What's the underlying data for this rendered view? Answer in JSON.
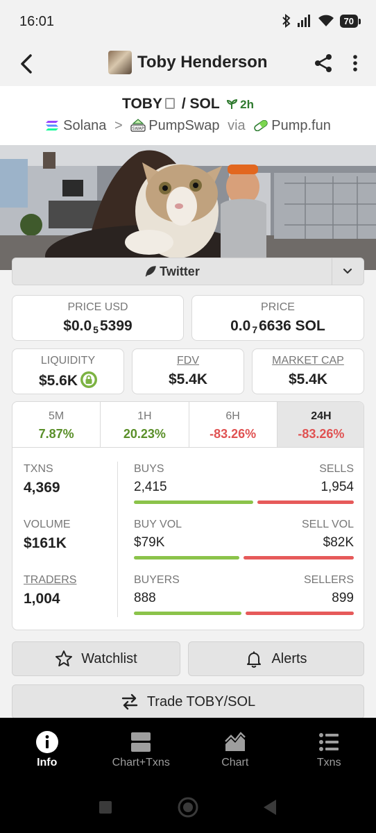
{
  "status_bar": {
    "time": "16:01",
    "battery": "70"
  },
  "header": {
    "title": "Toby Henderson"
  },
  "pair": {
    "base": "TOBY",
    "separator": "/",
    "quote": "SOL",
    "age": "2h",
    "chain": "Solana",
    "chevron": ">",
    "dex": "PumpSwap",
    "via": "via",
    "launchpad": "Pump.fun",
    "swap_badge": "SWAP"
  },
  "twitter": {
    "label": "Twitter"
  },
  "stats": {
    "price_usd": {
      "label": "PRICE USD",
      "prefix": "$0.0",
      "zeros": "5",
      "digits": "5399"
    },
    "price_native": {
      "label": "PRICE",
      "prefix": "0.0",
      "zeros": "7",
      "digits": "6636 SOL"
    },
    "liquidity": {
      "label": "LIQUIDITY",
      "value": "$5.6K"
    },
    "fdv": {
      "label": "FDV",
      "value": "$5.4K"
    },
    "market_cap": {
      "label": "MARKET CAP",
      "value": "$5.4K"
    }
  },
  "timeframes": [
    {
      "label": "5M",
      "change": "7.87%"
    },
    {
      "label": "1H",
      "change": "20.23%"
    },
    {
      "label": "6H",
      "change": "-83.26%"
    },
    {
      "label": "24H",
      "change": "-83.26%"
    }
  ],
  "activity": {
    "txns": {
      "label": "TXNS",
      "value": "4,369"
    },
    "volume": {
      "label": "VOLUME",
      "value": "$161K"
    },
    "traders": {
      "label": "TRADERS",
      "value": "1,004"
    },
    "buys_sells": {
      "a_label": "BUYS",
      "a_value": "2,415",
      "b_label": "SELLS",
      "b_value": "1,954",
      "a_share": 0.553
    },
    "vols": {
      "a_label": "BUY VOL",
      "a_value": "$79K",
      "b_label": "SELL VOL",
      "b_value": "$82K",
      "a_share": 0.49
    },
    "makers": {
      "a_label": "BUYERS",
      "a_value": "888",
      "b_label": "SELLERS",
      "b_value": "899",
      "a_share": 0.497
    }
  },
  "actions": {
    "watchlist": "Watchlist",
    "alerts": "Alerts",
    "trade": "Trade TOBY/SOL"
  },
  "bottom_nav": [
    {
      "label": "Info",
      "icon": "info-icon"
    },
    {
      "label": "Chart+Txns",
      "icon": "chart-txns-icon"
    },
    {
      "label": "Chart",
      "icon": "area-chart-icon"
    },
    {
      "label": "Txns",
      "icon": "list-icon"
    }
  ],
  "colors": {
    "positive": "#5a8f29",
    "negative": "#e05252",
    "buy_bar": "#8bc34a",
    "sell_bar": "#e65a5a"
  }
}
